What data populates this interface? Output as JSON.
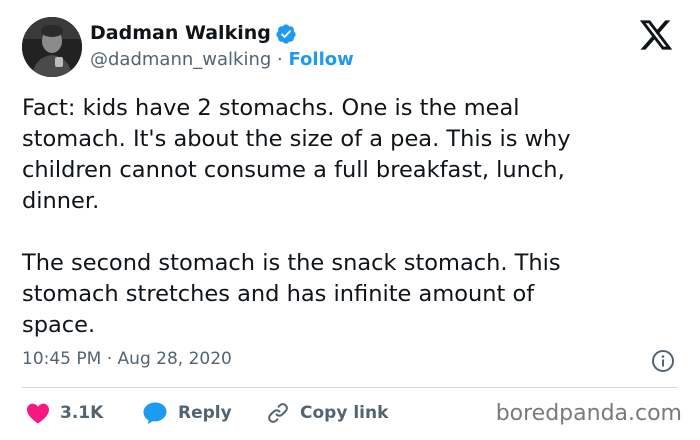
{
  "author": {
    "display_name": "Dadman Walking",
    "handle": "@dadmann_walking",
    "separator": "·",
    "follow_label": "Follow",
    "verified_color": "#1d9bf0"
  },
  "tweet": {
    "lines_para1": [
      "Fact: kids have 2 stomachs. One is the meal",
      "stomach. It's about the size of a pea. This is why",
      "children cannot consume a full breakfast, lunch,",
      "dinner."
    ],
    "lines_para2": [
      "The second stomach is the snack stomach. This",
      "stomach stretches and has infinite amount of",
      "space."
    ]
  },
  "meta": {
    "time": "10:45 PM",
    "separator": "·",
    "date": "Aug 28, 2020"
  },
  "actions": {
    "like_count": "3.1K",
    "reply_label": "Reply",
    "copy_label": "Copy link",
    "like_color": "#f91880",
    "reply_color": "#1d9bf0"
  },
  "watermark": "boredpanda.com",
  "icons": [
    "x-logo-icon",
    "verified-badge-icon",
    "info-icon",
    "heart-icon",
    "reply-bubble-icon",
    "link-icon"
  ]
}
